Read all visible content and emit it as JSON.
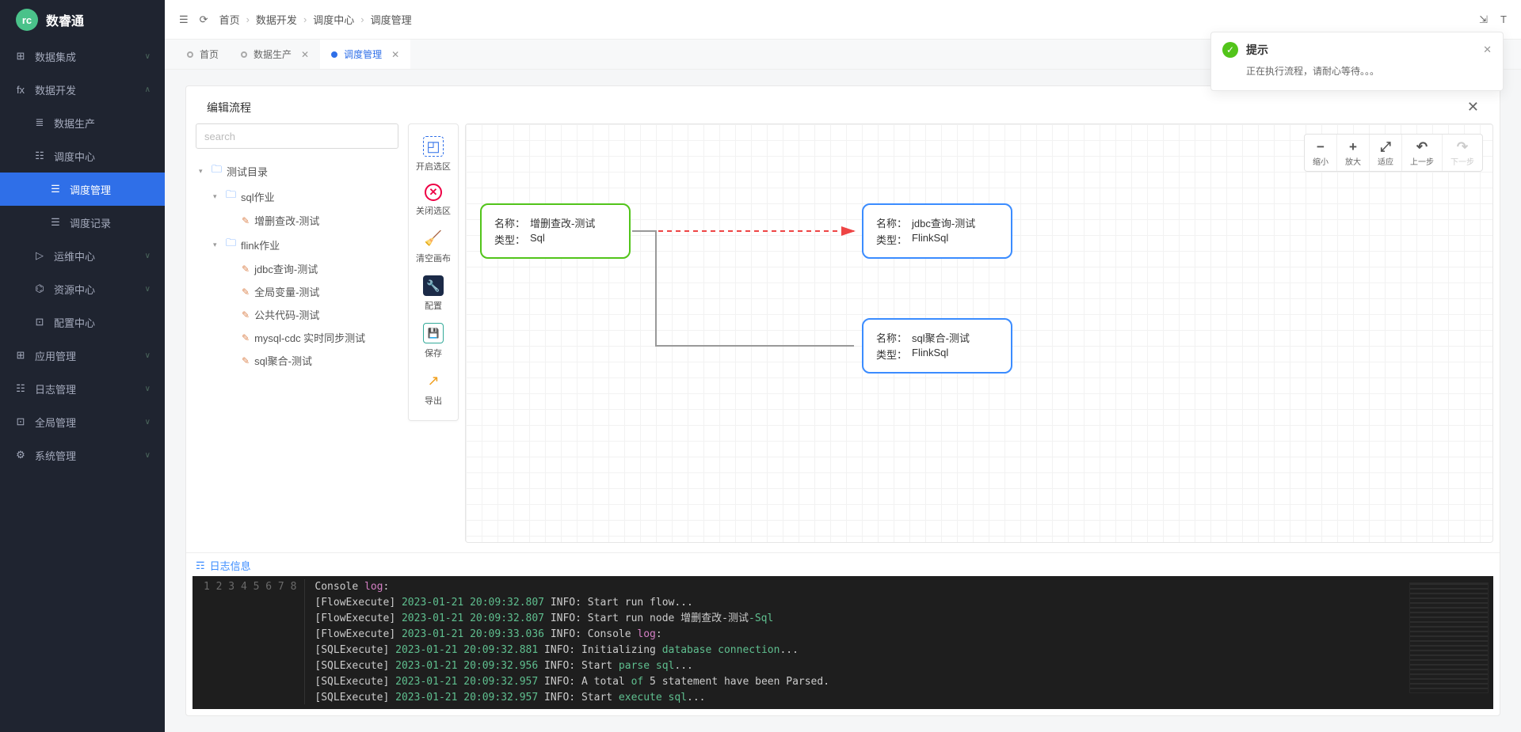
{
  "app": {
    "logo_text": "数睿通",
    "logo_abbr": "rc"
  },
  "nav": {
    "items": [
      {
        "icon": "⊞",
        "label": "数据集成",
        "arrow": "∨"
      },
      {
        "icon": "fx",
        "label": "数据开发",
        "arrow": "∧"
      }
    ],
    "dev_children": [
      {
        "icon": "≣",
        "label": "数据生产"
      },
      {
        "icon": "☷",
        "label": "调度中心",
        "children": [
          {
            "icon": "☰",
            "label": "调度管理",
            "active": true
          },
          {
            "icon": "☰",
            "label": "调度记录"
          }
        ]
      },
      {
        "icon": "▷",
        "label": "运维中心",
        "arrow": "∨"
      },
      {
        "icon": "⌬",
        "label": "资源中心",
        "arrow": "∨"
      },
      {
        "icon": "⊡",
        "label": "配置中心"
      }
    ],
    "rest": [
      {
        "icon": "⊞",
        "label": "应用管理",
        "arrow": "∨"
      },
      {
        "icon": "☷",
        "label": "日志管理",
        "arrow": "∨"
      },
      {
        "icon": "⊡",
        "label": "全局管理",
        "arrow": "∨"
      },
      {
        "icon": "⚙",
        "label": "系统管理",
        "arrow": "∨"
      }
    ]
  },
  "breadcrumb": [
    "首页",
    "数据开发",
    "调度中心",
    "调度管理"
  ],
  "tabs": [
    {
      "label": "首页",
      "active": false,
      "closeable": false
    },
    {
      "label": "数据生产",
      "active": false,
      "closeable": true
    },
    {
      "label": "调度管理",
      "active": true,
      "closeable": true
    }
  ],
  "panel": {
    "title": "编辑流程",
    "search_placeholder": "search"
  },
  "tree": {
    "root": "测试目录",
    "folders": [
      {
        "name": "sql作业",
        "children": [
          {
            "name": "增删查改-测试"
          }
        ]
      },
      {
        "name": "flink作业",
        "children": [
          {
            "name": "jdbc查询-测试"
          },
          {
            "name": "全局变量-测试"
          },
          {
            "name": "公共代码-测试"
          },
          {
            "name": "mysql-cdc 实时同步测试"
          },
          {
            "name": "sql聚合-测试"
          }
        ]
      }
    ]
  },
  "toolbar": [
    {
      "id": "open-select",
      "label": "开启选区"
    },
    {
      "id": "close-select",
      "label": "关闭选区"
    },
    {
      "id": "clear-canvas",
      "label": "清空画布"
    },
    {
      "id": "config",
      "label": "配置"
    },
    {
      "id": "save",
      "label": "保存"
    },
    {
      "id": "export",
      "label": "导出"
    }
  ],
  "zoom": [
    {
      "icon": "−",
      "label": "缩小"
    },
    {
      "icon": "+",
      "label": "放大"
    },
    {
      "icon": "⤢",
      "label": "适应"
    },
    {
      "icon": "↶",
      "label": "上一步"
    },
    {
      "icon": "↷",
      "label": "下一步",
      "disabled": true
    }
  ],
  "nodes": {
    "labels": {
      "name": "名称：",
      "type": "类型："
    },
    "n1": {
      "name": "增删查改-测试",
      "type": "Sql"
    },
    "n2": {
      "name": "jdbc查询-测试",
      "type": "FlinkSql"
    },
    "n3": {
      "name": "sql聚合-测试",
      "type": "FlinkSql"
    }
  },
  "logs": {
    "header": "日志信息",
    "lines": [
      [
        [
          "",
          "Console "
        ],
        [
          "c-key",
          "log"
        ],
        [
          "",
          ":"
        ]
      ],
      [
        [
          "",
          "[FlowExecute] "
        ],
        [
          "c-date",
          "2023-01-21 20:09:32.807"
        ],
        [
          "",
          " INFO: Start run flow..."
        ]
      ],
      [
        [
          "",
          "[FlowExecute] "
        ],
        [
          "c-date",
          "2023-01-21 20:09:32.807"
        ],
        [
          "",
          " INFO: Start run node 增删查改-测试"
        ],
        [
          "c-sql",
          "-Sql"
        ]
      ],
      [
        [
          "",
          "[FlowExecute] "
        ],
        [
          "c-date",
          "2023-01-21 20:09:33.036"
        ],
        [
          "",
          " INFO: Console "
        ],
        [
          "c-key",
          "log"
        ],
        [
          "",
          ":"
        ]
      ],
      [
        [
          "",
          "[SQLExecute] "
        ],
        [
          "c-date",
          "2023-01-21 20:09:32.881"
        ],
        [
          "",
          " INFO: Initializing "
        ],
        [
          "c-sql",
          "database connection"
        ],
        [
          "",
          "..."
        ]
      ],
      [
        [
          "",
          "[SQLExecute] "
        ],
        [
          "c-date",
          "2023-01-21 20:09:32.956"
        ],
        [
          "",
          " INFO: Start "
        ],
        [
          "c-sql",
          "parse sql"
        ],
        [
          "",
          "..."
        ]
      ],
      [
        [
          "",
          "[SQLExecute] "
        ],
        [
          "c-date",
          "2023-01-21 20:09:32.957"
        ],
        [
          "",
          " INFO: A total "
        ],
        [
          "c-sql",
          "of"
        ],
        [
          "",
          " 5 statement have been Parsed."
        ]
      ],
      [
        [
          "",
          "[SQLExecute] "
        ],
        [
          "c-date",
          "2023-01-21 20:09:32.957"
        ],
        [
          "",
          " INFO: Start "
        ],
        [
          "c-sql",
          "execute sql"
        ],
        [
          "",
          "..."
        ]
      ]
    ]
  },
  "toast": {
    "title": "提示",
    "body": "正在执行流程，请耐心等待。。。"
  }
}
